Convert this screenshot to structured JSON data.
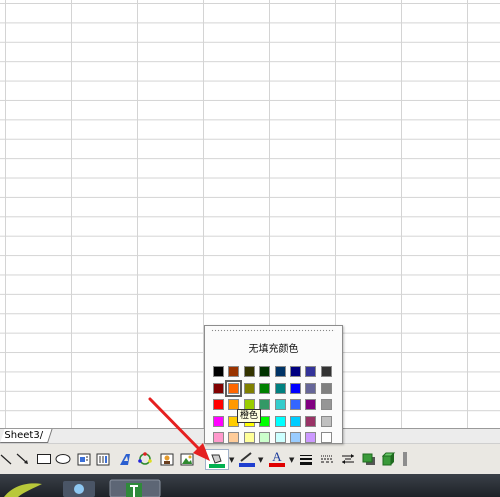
{
  "sheet_tabs": [
    {
      "label": "Sheet3/"
    }
  ],
  "palette": {
    "title": "无填充颜色",
    "selected": "橙色",
    "tooltip": "橙色",
    "rows": [
      [
        "#000000",
        "#993300",
        "#333300",
        "#003300",
        "#003366",
        "#000080",
        "#333399",
        "#333333"
      ],
      [
        "#800000",
        "#FF6600",
        "#808000",
        "#008000",
        "#008080",
        "#0000FF",
        "#666699",
        "#808080"
      ],
      [
        "#FF0000",
        "#FF9900",
        "#99CC00",
        "#339966",
        "#33CCCC",
        "#3366FF",
        "#800080",
        "#969696"
      ],
      [
        "#FF00FF",
        "#FFCC00",
        "#FFFF00",
        "#00FF00",
        "#00FFFF",
        "#00CCFF",
        "#993366",
        "#C0C0C0"
      ],
      [
        "#FF99CC",
        "#FFCC99",
        "#FFFF99",
        "#CCFFCC",
        "#CCFFFF",
        "#99CCFF",
        "#CC99FF",
        "#FFFFFF"
      ]
    ]
  },
  "drawing_toolbar": {
    "tools": [
      "line-icon",
      "arrow-icon",
      "rectangle-icon",
      "oval-icon",
      "textbox-icon",
      "vertical-textbox-icon",
      "wordart-icon",
      "diagram-icon",
      "clipart-icon",
      "picture-icon",
      "fill-color-icon",
      "line-color-icon",
      "font-color-icon",
      "line-style-icon",
      "dash-style-icon",
      "arrow-style-icon",
      "shadow-icon",
      "3d-icon"
    ],
    "fill_color": "#00B050",
    "line_color": "#1F3FCF",
    "font_color": "#E00000",
    "font_letter": "A"
  },
  "annotation_arrow_color": "#E52020"
}
